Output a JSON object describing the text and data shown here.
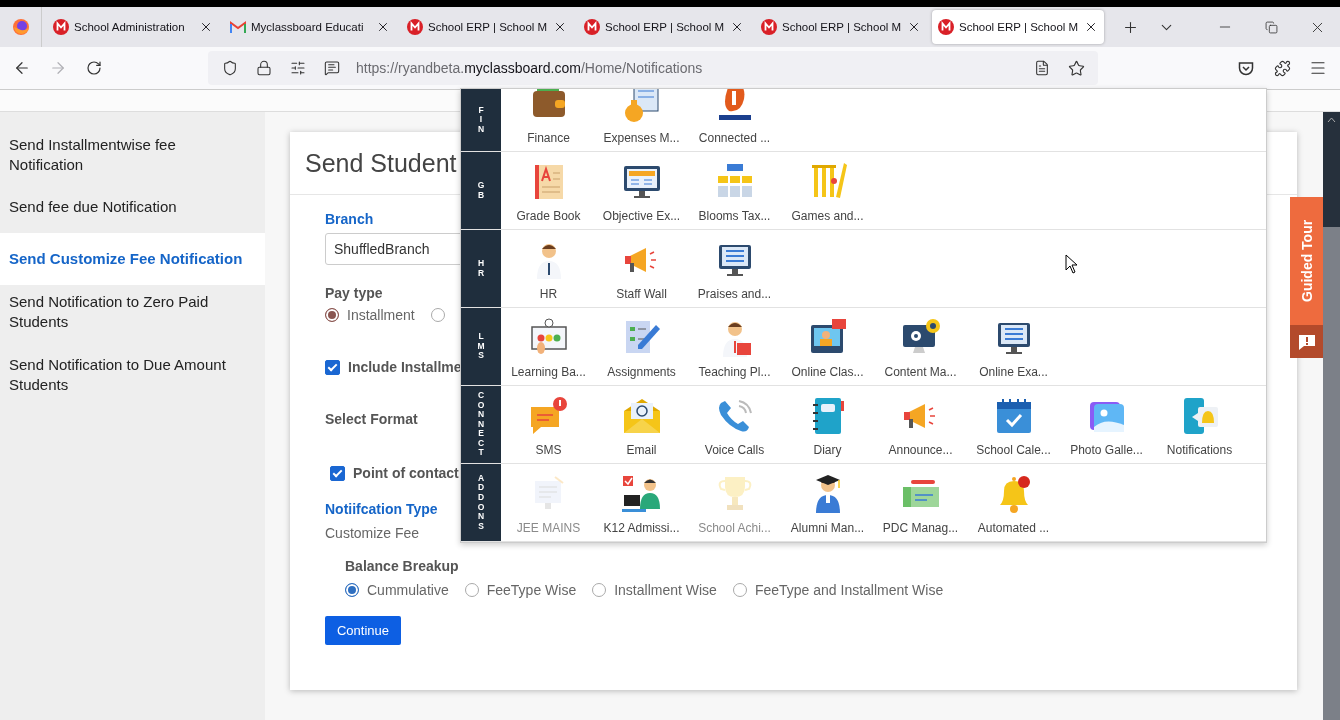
{
  "browser": {
    "tabs": [
      {
        "title": "School Administration",
        "kind": "site",
        "selected": false
      },
      {
        "title": "Myclassboard Educati",
        "kind": "mail",
        "selected": false
      },
      {
        "title": "School ERP | School M",
        "kind": "site",
        "selected": false
      },
      {
        "title": "School ERP | School M",
        "kind": "site",
        "selected": false
      },
      {
        "title": "School ERP | School M",
        "kind": "site",
        "selected": false
      },
      {
        "title": "School ERP | School M",
        "kind": "site",
        "selected": true
      }
    ],
    "url": {
      "prefix": "https://ryandbeta.",
      "domain": "myclassboard.com",
      "path": "/Home/Notifications"
    }
  },
  "sidebar": {
    "items": [
      {
        "label": "Send Installmentwise fee Notification",
        "selected": false
      },
      {
        "label": "Send fee due Notification",
        "selected": false
      },
      {
        "label": "Send Customize Fee Notification",
        "selected": true
      },
      {
        "label": "Send Notification to Zero Paid Students",
        "selected": false
      },
      {
        "label": "Send Notification to Due Amount Students",
        "selected": false
      }
    ]
  },
  "form": {
    "title": "Send Student",
    "branch": {
      "label": "Branch",
      "value": "ShuffledBranch"
    },
    "pay_type": {
      "label": "Pay type",
      "options": [
        {
          "label": "Installment",
          "selected": true
        },
        {
          "selected": false
        }
      ]
    },
    "include_installments": {
      "label": "Include Installme",
      "checked": true
    },
    "select_format": {
      "label": "Select Format"
    },
    "point_of_contact": {
      "label": "Point of contact",
      "checked": true
    },
    "notification_type": {
      "label": "Notiifcation Type",
      "value": "Customize Fee"
    },
    "balance_breakup": {
      "label": "Balance Breakup",
      "options": [
        {
          "label": "Cummulative",
          "selected": true
        },
        {
          "label": "FeeType Wise",
          "selected": false
        },
        {
          "label": "Installment Wise",
          "selected": false
        },
        {
          "label": "FeeType and Installment Wise",
          "selected": false
        }
      ]
    },
    "continue_button": "Continue"
  },
  "app_menu": {
    "groups": [
      {
        "label": "FIN",
        "apps": [
          {
            "name": "Finance",
            "disabled": false
          },
          {
            "name": "Expenses M...",
            "disabled": false
          },
          {
            "name": "Connected ...",
            "disabled": false
          }
        ]
      },
      {
        "label": "GB",
        "apps": [
          {
            "name": "Grade Book",
            "disabled": false
          },
          {
            "name": "Objective Ex...",
            "disabled": false
          },
          {
            "name": "Blooms Tax...",
            "disabled": false
          },
          {
            "name": "Games and...",
            "disabled": false
          }
        ]
      },
      {
        "label": "HR",
        "apps": [
          {
            "name": "HR",
            "disabled": false
          },
          {
            "name": "Staff Wall",
            "disabled": false
          },
          {
            "name": "Praises and...",
            "disabled": false
          }
        ]
      },
      {
        "label": "LMS",
        "apps": [
          {
            "name": "Learning Ba...",
            "disabled": false
          },
          {
            "name": "Assignments",
            "disabled": false
          },
          {
            "name": "Teaching Pl...",
            "disabled": false
          },
          {
            "name": "Online Clas...",
            "disabled": false
          },
          {
            "name": "Content Ma...",
            "disabled": false
          },
          {
            "name": "Online Exa...",
            "disabled": false
          }
        ]
      },
      {
        "label": "CONNECT",
        "apps": [
          {
            "name": "SMS",
            "disabled": false
          },
          {
            "name": "Email",
            "disabled": false
          },
          {
            "name": "Voice Calls",
            "disabled": false
          },
          {
            "name": "Diary",
            "disabled": false
          },
          {
            "name": "Announce...",
            "disabled": false
          },
          {
            "name": "School Cale...",
            "disabled": false
          },
          {
            "name": "Photo Galle...",
            "disabled": false
          },
          {
            "name": "Notifications",
            "disabled": false
          }
        ]
      },
      {
        "label": "ADDONS",
        "apps": [
          {
            "name": "JEE MAINS",
            "disabled": true
          },
          {
            "name": "K12 Admissi...",
            "disabled": false
          },
          {
            "name": "School Achi...",
            "disabled": true
          },
          {
            "name": "Alumni Man...",
            "disabled": false
          },
          {
            "name": "PDC Manag...",
            "disabled": false
          },
          {
            "name": "Automated ...",
            "disabled": false
          }
        ]
      }
    ]
  },
  "guided_tour": {
    "label": "Guided Tour"
  }
}
